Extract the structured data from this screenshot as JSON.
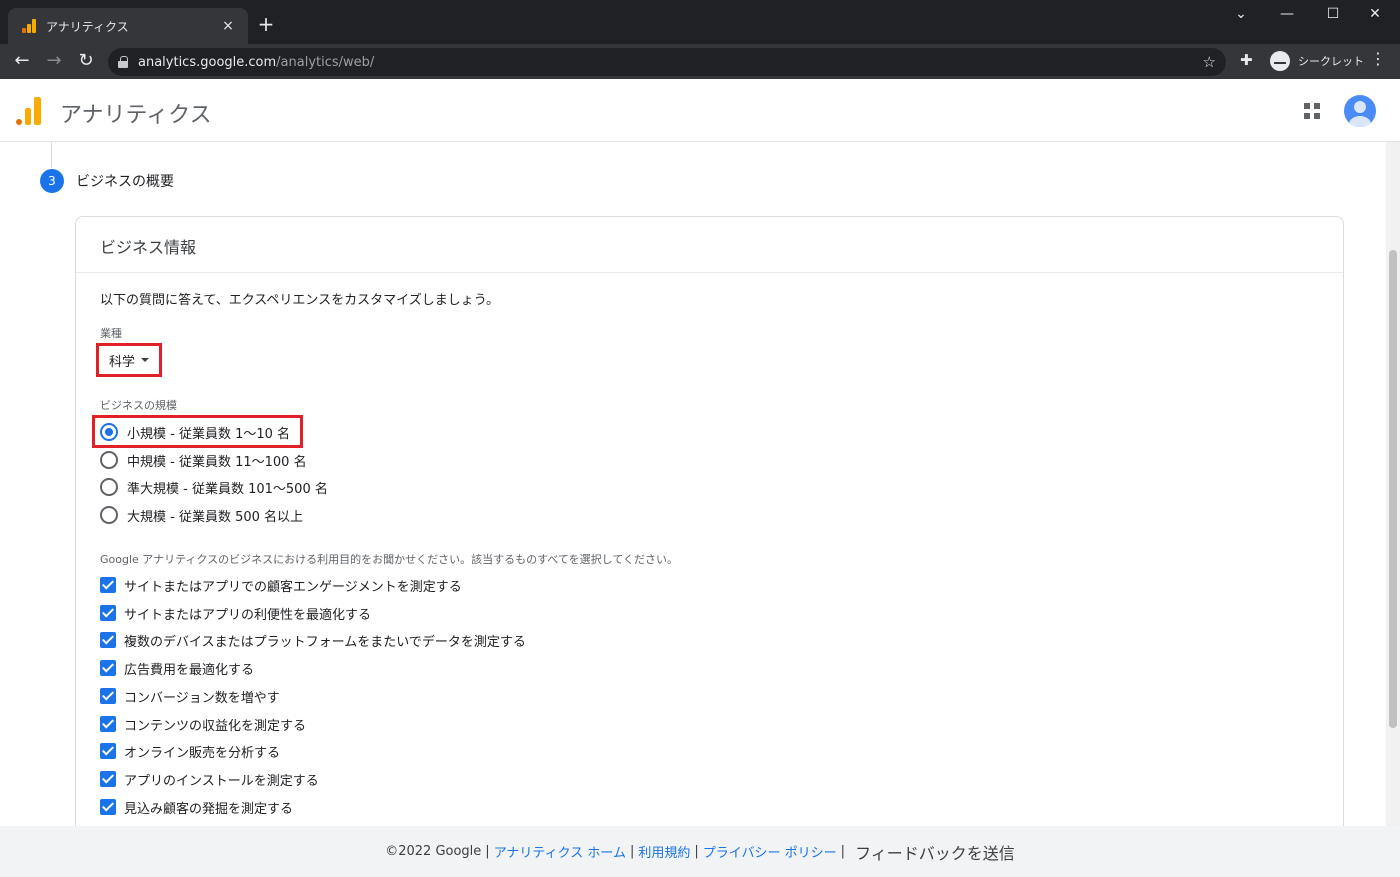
{
  "browser": {
    "tab_title": "アナリティクス",
    "tab_close": "×",
    "new_tab": "+",
    "url_host": "analytics.google.com",
    "url_path": "/analytics/web/",
    "incognito_label": "シークレット",
    "window_controls": [
      "⌄",
      "—",
      "☐",
      "✕"
    ],
    "icons": [
      "back-icon",
      "forward-icon",
      "reload-icon",
      "lock-icon",
      "star-icon",
      "extensions-icon",
      "incognito-icon",
      "more-icon"
    ]
  },
  "app": {
    "title": "アナリティクス",
    "logo_colors": [
      "#f9ab00",
      "#e37400"
    ]
  },
  "step": {
    "number": "3",
    "title": "ビジネスの概要"
  },
  "card": {
    "title": "ビジネス情報",
    "intro": "以下の質問に答えて、エクスペリエンスをカスタマイズしましょう。",
    "industry_label": "業種",
    "industry_value": "科学",
    "size_label": "ビジネスの規模",
    "size_options": [
      {
        "label": "小規模 - 従業員数 1〜10 名",
        "checked": true
      },
      {
        "label": "中規模 - 従業員数 11〜100 名",
        "checked": false
      },
      {
        "label": "準大規模 - 従業員数 101〜500 名",
        "checked": false
      },
      {
        "label": "大規模 - 従業員数 500 名以上",
        "checked": false
      }
    ],
    "purpose_label": "Google アナリティクスのビジネスにおける利用目的をお聞かせください。該当するものすべてを選択してください。",
    "purposes": [
      {
        "label": "サイトまたはアプリでの顧客エンゲージメントを測定する",
        "checked": true
      },
      {
        "label": "サイトまたはアプリの利便性を最適化する",
        "checked": true
      },
      {
        "label": "複数のデバイスまたはプラットフォームをまたいでデータを測定する",
        "checked": true
      },
      {
        "label": "広告費用を最適化する",
        "checked": true
      },
      {
        "label": "コンバージョン数を増やす",
        "checked": true
      },
      {
        "label": "コンテンツの収益化を測定する",
        "checked": true
      },
      {
        "label": "オンライン販売を分析する",
        "checked": true
      },
      {
        "label": "アプリのインストールを測定する",
        "checked": true
      },
      {
        "label": "見込み顧客の発掘を測定する",
        "checked": true
      }
    ]
  },
  "footer": {
    "copyright": "©2022 Google",
    "sep": "|",
    "home_link": "アナリティクス ホーム",
    "terms_link": "利用規約",
    "privacy_link": "プライバシー ポリシー",
    "feedback": "フィードバックを送信"
  },
  "colors": {
    "accent": "#1a73e8",
    "highlight": "#e02127"
  }
}
